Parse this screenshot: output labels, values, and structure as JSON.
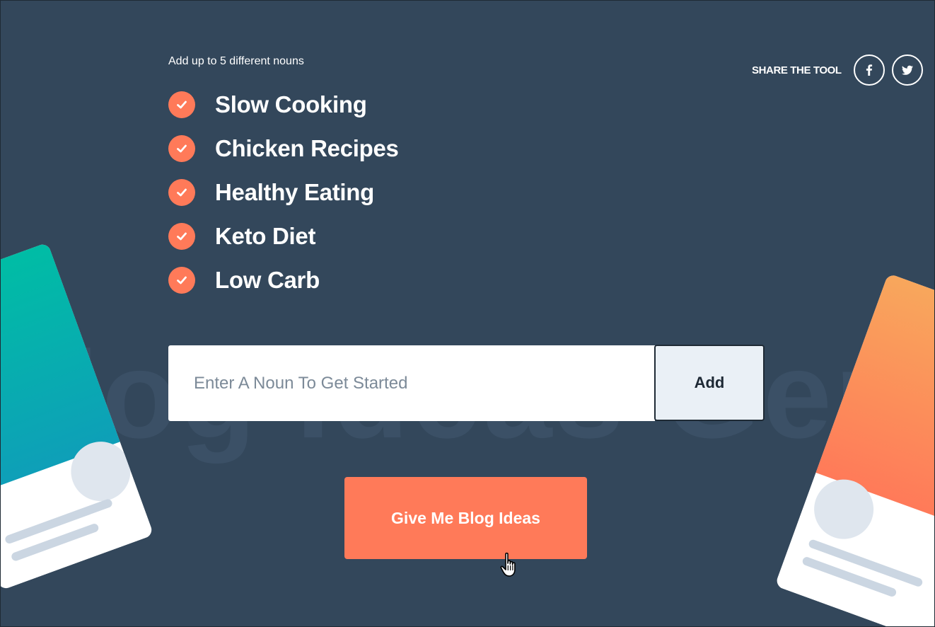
{
  "watermark_text": "Blog Ideas Generator",
  "intro": {
    "text": "Add up to 5 different nouns"
  },
  "nouns": [
    {
      "label": "Slow Cooking",
      "checked": true
    },
    {
      "label": "Chicken Recipes",
      "checked": true
    },
    {
      "label": "Healthy Eating",
      "checked": true
    },
    {
      "label": "Keto Diet",
      "checked": true
    },
    {
      "label": "Low Carb",
      "checked": true
    }
  ],
  "share": {
    "label": "SHARE THE TOOL",
    "networks": [
      {
        "icon": "facebook-icon"
      },
      {
        "icon": "twitter-icon"
      }
    ]
  },
  "form": {
    "input_value": "",
    "input_placeholder": "Enter A Noun To Get Started",
    "add_label": "Add",
    "submit_label": "Give Me Blog Ideas"
  },
  "colors": {
    "background": "#33475b",
    "accent": "#ff7a59",
    "input_bg": "#ffffff",
    "add_button_bg": "#eaf0f6",
    "left_card_gradient": [
      "#00bda5",
      "#0e9fb8"
    ],
    "right_card_gradient": [
      "#f8a75c",
      "#ff7a59"
    ]
  },
  "icons": [
    "check-icon",
    "facebook-icon",
    "twitter-icon",
    "hand-pointer-icon"
  ]
}
